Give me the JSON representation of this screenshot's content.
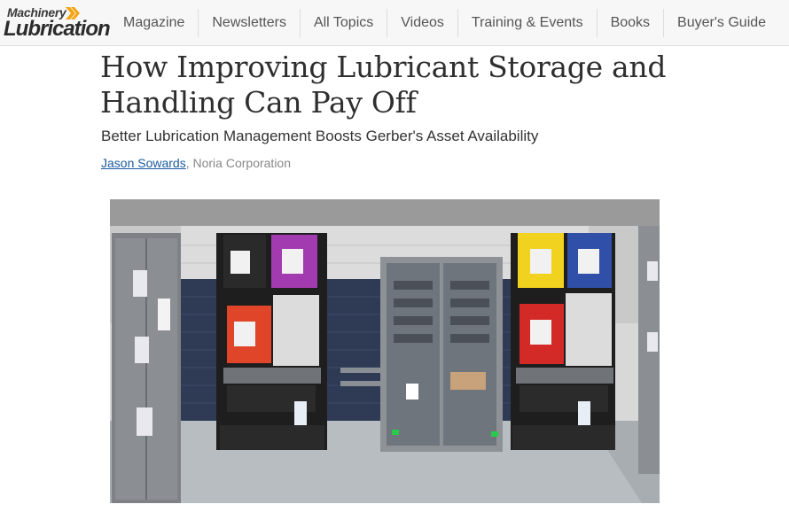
{
  "logo": {
    "line1": "Machinery",
    "line2": "Lubrication"
  },
  "nav": {
    "items": [
      {
        "label": "Magazine"
      },
      {
        "label": "Newsletters"
      },
      {
        "label": "All Topics"
      },
      {
        "label": "Videos"
      },
      {
        "label": "Training & Events"
      },
      {
        "label": "Books"
      },
      {
        "label": "Buyer's Guide"
      }
    ]
  },
  "article": {
    "title": "How Improving Lubricant Storage and Handling Can Pay Off",
    "subtitle": "Better Lubrication Management Boosts Gerber's Asset Availability",
    "author": "Jason Sowards",
    "separator": ", ",
    "organization": "Noria Corporation"
  },
  "colors": {
    "accent": "#f2a516",
    "link": "#1a5a9e",
    "nav_bg": "#f7f7f7"
  }
}
